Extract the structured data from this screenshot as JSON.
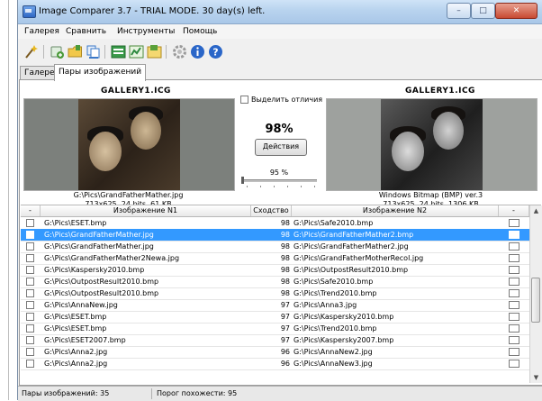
{
  "window": {
    "title": "Image Comparer 3.7 - TRIAL MODE. 30 day(s) left.",
    "controls": {
      "minimize": "–",
      "maximize": "□",
      "close": "✕"
    }
  },
  "menu": [
    "Галерея",
    "Сравнить",
    "Инструменты",
    "Помощь"
  ],
  "toolbar": [
    {
      "icon": "wand-icon",
      "color": "#d8a020"
    },
    {
      "icon": "add-images-icon",
      "color": "#4a9a3a"
    },
    {
      "icon": "folder-add-icon",
      "color": "#e2b030"
    },
    {
      "icon": "copy-files-icon",
      "color": "#3a78c8"
    },
    {
      "icon": "compare-icon",
      "color": "#2e8a40"
    },
    {
      "icon": "results-icon",
      "color": "#5aa03a"
    },
    {
      "icon": "export-icon",
      "color": "#c8a020"
    },
    {
      "icon": "settings-icon",
      "color": "#9a9a9a"
    },
    {
      "icon": "info-icon",
      "color": "#2a66c8"
    },
    {
      "icon": "help-icon",
      "color": "#2a66c8"
    }
  ],
  "tabs": [
    {
      "label": "Галерея",
      "active": false
    },
    {
      "label": "Пары изображений",
      "active": true
    }
  ],
  "compare": {
    "left": {
      "gallery": "GALLERY1.ICG",
      "path": "G:\\Pics\\GrandFatherMather.jpg",
      "info": "713x625, 24 bits, 61 KB"
    },
    "right": {
      "gallery": "GALLERY1.ICG",
      "path": "Windows Bitmap (BMP) ver.3",
      "info": "713x625, 24 bits, 1306 KB"
    },
    "highlight_diff_label": "Выделить отличия",
    "highlight_diff_checked": false,
    "similarity": "98%",
    "actions_label": "Действия",
    "threshold_label": "95 %",
    "threshold_value": 0.0
  },
  "table": {
    "columns": [
      "-",
      "Изображение N1",
      "Сходство",
      "Изображение N2",
      "-"
    ],
    "rows": [
      {
        "img1": "G:\\Pics\\ESET.bmp",
        "sim": "98",
        "img2": "G:\\Pics\\Safe2010.bmp",
        "selected": false
      },
      {
        "img1": "G:\\Pics\\GrandFatherMather.jpg",
        "sim": "98",
        "img2": "G:\\Pics\\GrandFatherMather2.bmp",
        "selected": true
      },
      {
        "img1": "G:\\Pics\\GrandFatherMather.jpg",
        "sim": "98",
        "img2": "G:\\Pics\\GrandFatherMather2.jpg",
        "selected": false
      },
      {
        "img1": "G:\\Pics\\GrandFatherMather2Newa.jpg",
        "sim": "98",
        "img2": "G:\\Pics\\GrandFatherMotherRecol.jpg",
        "selected": false
      },
      {
        "img1": "G:\\Pics\\Kaspersky2010.bmp",
        "sim": "98",
        "img2": "G:\\Pics\\OutpostResult2010.bmp",
        "selected": false
      },
      {
        "img1": "G:\\Pics\\OutpostResult2010.bmp",
        "sim": "98",
        "img2": "G:\\Pics\\Safe2010.bmp",
        "selected": false
      },
      {
        "img1": "G:\\Pics\\OutpostResult2010.bmp",
        "sim": "98",
        "img2": "G:\\Pics\\Trend2010.bmp",
        "selected": false
      },
      {
        "img1": "G:\\Pics\\AnnaNew.jpg",
        "sim": "97",
        "img2": "G:\\Pics\\Anna3.jpg",
        "selected": false
      },
      {
        "img1": "G:\\Pics\\ESET.bmp",
        "sim": "97",
        "img2": "G:\\Pics\\Kaspersky2010.bmp",
        "selected": false
      },
      {
        "img1": "G:\\Pics\\ESET.bmp",
        "sim": "97",
        "img2": "G:\\Pics\\Trend2010.bmp",
        "selected": false
      },
      {
        "img1": "G:\\Pics\\ESET2007.bmp",
        "sim": "97",
        "img2": "G:\\Pics\\Kaspersky2007.bmp",
        "selected": false
      },
      {
        "img1": "G:\\Pics\\Anna2.jpg",
        "sim": "96",
        "img2": "G:\\Pics\\AnnaNew2.jpg",
        "selected": false
      },
      {
        "img1": "G:\\Pics\\Anna2.jpg",
        "sim": "96",
        "img2": "G:\\Pics\\AnnaNew3.jpg",
        "selected": false
      }
    ]
  },
  "status": {
    "pairs": "Пары изображений: 35",
    "threshold": "Порог похожести: 95"
  }
}
